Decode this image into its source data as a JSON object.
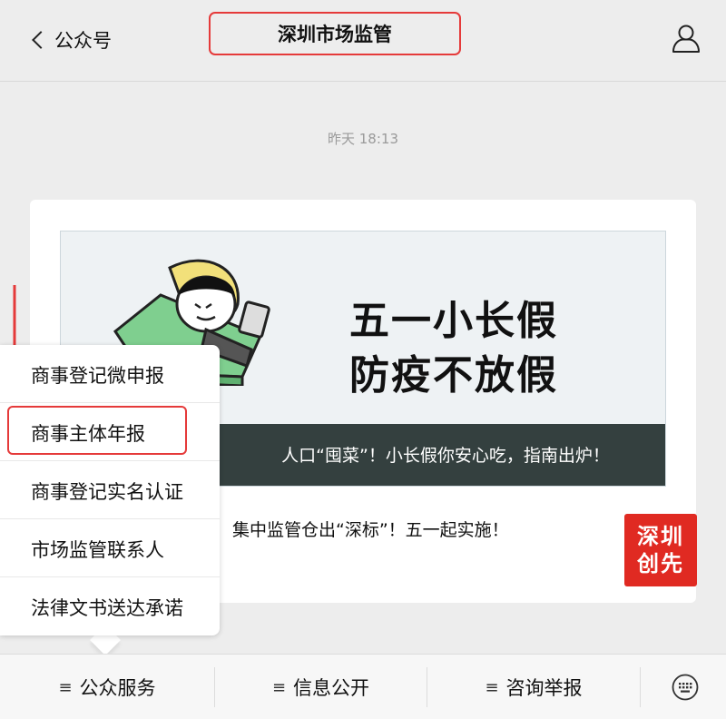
{
  "header": {
    "back_label": "公众号",
    "title": "深圳市场监管"
  },
  "chat": {
    "timestamp": "昨天 18:13"
  },
  "article": {
    "banner_line1": "五一小长假",
    "banner_line2": "防疫不放假",
    "headline_visible": "人口“囤菜”！小长假你安心吃，指南出炉！",
    "sub_headline_visible": "集中监管仓出“深标”！五一起实施！",
    "thumb_line1": "深圳",
    "thumb_line2": "创先"
  },
  "popup_menu": {
    "items": [
      {
        "label": "商事登记微申报"
      },
      {
        "label": "商事主体年报"
      },
      {
        "label": "商事登记实名认证"
      },
      {
        "label": "市场监管联系人"
      },
      {
        "label": "法律文书送达承诺"
      }
    ]
  },
  "bottom_menu": {
    "tabs": [
      {
        "label": "公众服务",
        "icon": "hamburger-icon"
      },
      {
        "label": "信息公开",
        "icon": "hamburger-icon"
      },
      {
        "label": "咨询举报",
        "icon": "hamburger-icon"
      }
    ],
    "hamburger_glyph": "≡"
  },
  "colors": {
    "annotation_red": "#e53a3a",
    "background": "#ededed",
    "thumb_red": "#e02a22",
    "banner_strip": "#34403f"
  }
}
